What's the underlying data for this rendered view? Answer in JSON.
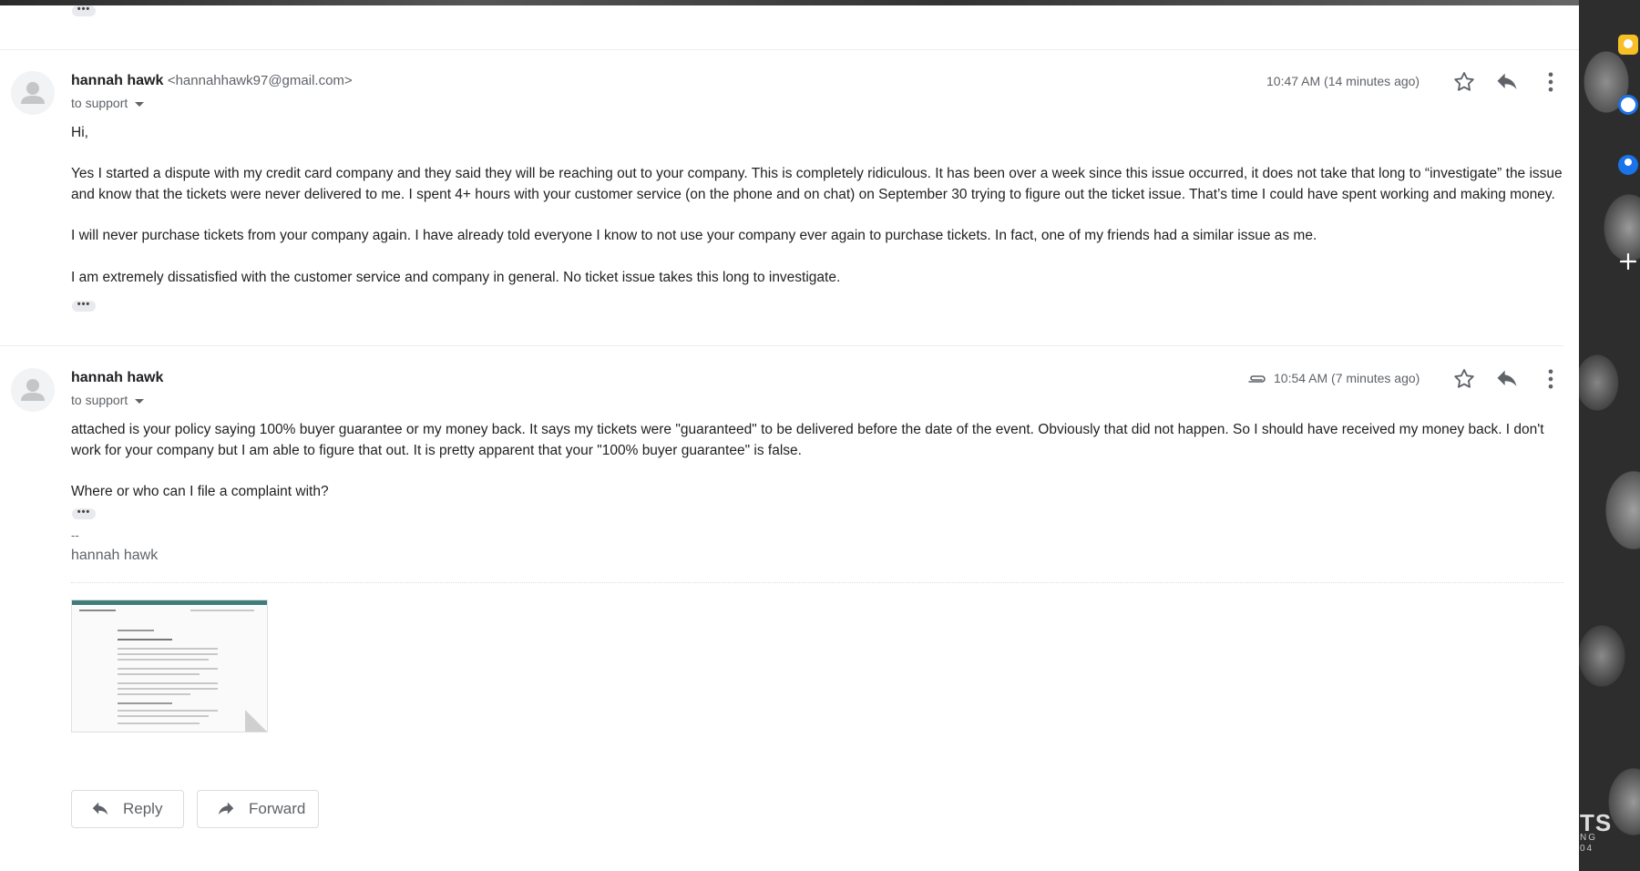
{
  "messages": [
    {
      "sender_name": "hannah hawk",
      "sender_email": "<hannahhawk97@gmail.com>",
      "to_line": "to support",
      "timestamp": "10:47 AM (14 minutes ago)",
      "paragraphs": [
        "Hi,",
        "Yes I started a dispute with my credit card company and they said they will be reaching out to your company. This is completely ridiculous. It has been over a week since this issue occurred, it does not take that long to “investigate” the issue and know that the tickets were never delivered to me. I spent 4+ hours with your customer service (on the phone and on chat) on September 30 trying to figure out the ticket issue. That’s time I could have spent working and making money.",
        "I will never purchase tickets from your company again. I have already told everyone I know to not use your company ever again to purchase tickets. In fact, one of my friends had a similar issue as me.",
        "I am extremely dissatisfied with the customer service and company in general. No ticket issue takes this long to investigate."
      ]
    },
    {
      "sender_name": "hannah hawk",
      "to_line": "to support",
      "timestamp": "10:54 AM (7 minutes ago)",
      "has_attachment": true,
      "paragraphs": [
        "attached is your policy saying 100% buyer guarantee or my money back. It says my tickets were \"guaranteed\" to be delivered before the date of the event. Obviously that did not happen. So I should have received my money back. I don't work for your company but I am able to figure that out. It is pretty apparent that your \"100% buyer guarantee\" is false.",
        "Where or who can I file a complaint with?"
      ],
      "signature_dash": "--",
      "signature_name": "hannah hawk"
    }
  ],
  "actions": {
    "reply_label": "Reply",
    "forward_label": "Forward"
  },
  "ellipsis": "•••",
  "watermark": {
    "large": "TS",
    "small": "NG",
    "small2": "04"
  },
  "colors": {
    "text": "#202124",
    "muted": "#5f6368",
    "keep_yellow": "#f6bf26",
    "tasks_blue": "#1a73e8",
    "contacts_blue": "#1a73e8"
  },
  "icons": {
    "star": "star-icon",
    "reply": "reply-icon",
    "more": "more-vert-icon",
    "attachment": "paperclip-icon"
  }
}
